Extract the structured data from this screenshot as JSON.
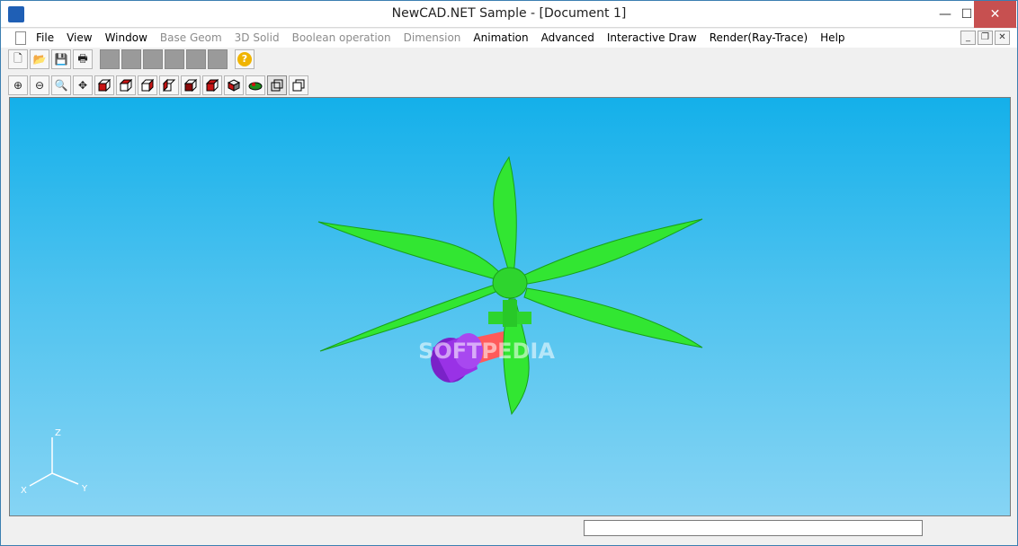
{
  "window": {
    "title": "NewCAD.NET Sample - [Document 1]",
    "minimize_glyph": "—",
    "maximize_glyph": "☐",
    "close_glyph": "✕"
  },
  "menu": {
    "items": [
      {
        "label": "File",
        "enabled": true
      },
      {
        "label": "View",
        "enabled": true
      },
      {
        "label": "Window",
        "enabled": true
      },
      {
        "label": "Base Geom",
        "enabled": false
      },
      {
        "label": "3D Solid",
        "enabled": false
      },
      {
        "label": "Boolean operation",
        "enabled": false
      },
      {
        "label": "Dimension",
        "enabled": false
      },
      {
        "label": "Animation",
        "enabled": true
      },
      {
        "label": "Advanced",
        "enabled": true
      },
      {
        "label": "Interactive Draw",
        "enabled": true
      },
      {
        "label": "Render(Ray-Trace)",
        "enabled": true
      },
      {
        "label": "Help",
        "enabled": true
      }
    ],
    "mdi_minimize": "_",
    "mdi_restore": "❐",
    "mdi_close": "✕"
  },
  "toolbar1": {
    "new": "🗋",
    "open": "📂",
    "save": "💾",
    "print": "🖶",
    "help": "?"
  },
  "toolbar2": {
    "zoom_all": "⊕",
    "zoom_window": "⊖",
    "zoom_in": "🔍",
    "pan": "✥"
  },
  "viewport": {
    "axes": {
      "z": "Z",
      "x": "X",
      "y": "Y"
    },
    "colors": {
      "blades": "#32e632",
      "piston": "#9932e6",
      "rod": "#ff5a5a",
      "bg_top": "#14b0ea",
      "bg_bottom": "#86d4f4"
    },
    "watermark": "SOFTPEDIA"
  },
  "status": {
    "text": ""
  }
}
